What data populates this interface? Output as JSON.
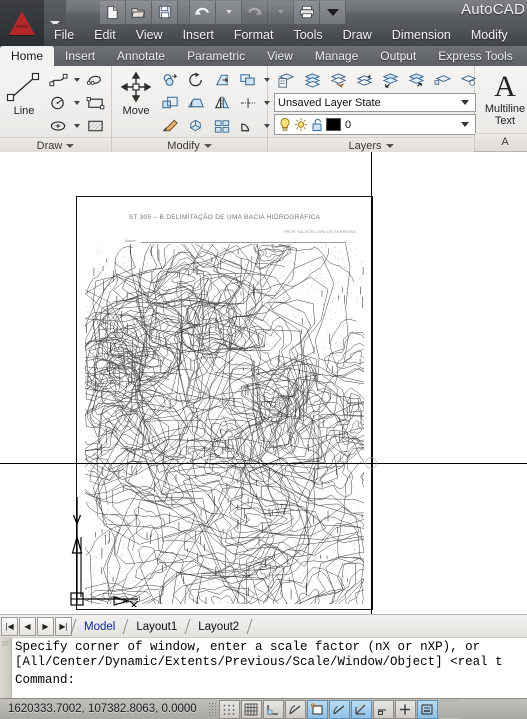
{
  "app": {
    "title": "AutoCAD",
    "logo_icon": "autocad-a-logo"
  },
  "quick_access": {
    "items": [
      {
        "name": "new-icon",
        "label": "New"
      },
      {
        "name": "open-icon",
        "label": "Open"
      },
      {
        "name": "save-icon",
        "label": "Save"
      },
      {
        "name": "undo-icon",
        "label": "Undo"
      },
      {
        "name": "redo-icon",
        "label": "Redo"
      },
      {
        "name": "plot-icon",
        "label": "Plot"
      },
      {
        "name": "chevron-down-icon",
        "label": "Customize Quick Access Toolbar"
      }
    ]
  },
  "menubar": {
    "items": [
      {
        "label": "File"
      },
      {
        "label": "Edit"
      },
      {
        "label": "View"
      },
      {
        "label": "Insert"
      },
      {
        "label": "Format"
      },
      {
        "label": "Tools"
      },
      {
        "label": "Draw"
      },
      {
        "label": "Dimension"
      },
      {
        "label": "Modify"
      }
    ]
  },
  "ribbon": {
    "tabs": [
      {
        "label": "Home",
        "active": true
      },
      {
        "label": "Insert",
        "active": false
      },
      {
        "label": "Annotate",
        "active": false
      },
      {
        "label": "Parametric",
        "active": false
      },
      {
        "label": "View",
        "active": false
      },
      {
        "label": "Manage",
        "active": false
      },
      {
        "label": "Output",
        "active": false
      },
      {
        "label": "Express Tools",
        "active": false
      }
    ],
    "panels": [
      {
        "title": "Draw",
        "big_button": {
          "label": "Line",
          "icon": "line-icon"
        },
        "buttons": [
          {
            "name": "polyline-icon",
            "dropdown": true
          },
          {
            "name": "spline-icon",
            "dropdown": false
          },
          {
            "name": "circle-icon",
            "dropdown": true
          },
          {
            "name": "rectangle-icon",
            "dropdown": false
          },
          {
            "name": "ellipse-icon",
            "dropdown": true
          },
          {
            "name": "hatch-icon",
            "dropdown": false
          }
        ]
      },
      {
        "title": "Modify",
        "big_button": {
          "label": "Move",
          "icon": "move-icon"
        },
        "buttons": [
          {
            "name": "copy-icon",
            "dropdown": false
          },
          {
            "name": "rotate-icon",
            "dropdown": false
          },
          {
            "name": "trim-icon",
            "dropdown": false
          },
          {
            "name": "array-icon",
            "dropdown": true
          },
          {
            "name": "scale-icon",
            "dropdown": false
          },
          {
            "name": "stretch-icon",
            "dropdown": false
          },
          {
            "name": "mirror-icon",
            "dropdown": false
          },
          {
            "name": "fillet-icon",
            "dropdown": true
          },
          {
            "name": "erase-icon",
            "dropdown": false
          },
          {
            "name": "explode-icon",
            "dropdown": false
          },
          {
            "name": "offset-icon",
            "dropdown": false
          },
          {
            "name": "chamfer-icon",
            "dropdown": true
          }
        ]
      },
      {
        "title": "Layers",
        "tools": [
          {
            "name": "layer-properties-icon"
          },
          {
            "name": "layer-isolate-icon"
          },
          {
            "name": "layer-freeze-icon"
          },
          {
            "name": "layer-match-icon"
          },
          {
            "name": "layer-previous-icon"
          },
          {
            "name": "layer-make-current-icon"
          },
          {
            "name": "layer-merge-icon"
          },
          {
            "name": "layer-walk-icon"
          }
        ],
        "layer_state": {
          "value": "Unsaved Layer State",
          "name": "layer-state-combo"
        },
        "current_layer": {
          "value": "0",
          "color_swatch": "#000000",
          "toggles": [
            "lightbulb-icon",
            "sun-icon",
            "unlock-icon"
          ],
          "name": "current-layer-combo"
        }
      },
      {
        "title": "A",
        "big_button": {
          "label_line1": "Multiline",
          "label_line2": "Text",
          "icon": "text-a-icon"
        }
      }
    ]
  },
  "drawing": {
    "sheet": {
      "title": "ST 305 – B   DELIMITAÇÃO DE UMA BACIA HIDROGRÁFICA",
      "subtitle": "PROF. NILSON  CARLOS FERREIRA",
      "label_left": "Nome:",
      "label_date": "Data:",
      "description": "scanned-topographic-contour-map"
    },
    "ucs_icon": "ucs-coordinate-icon",
    "crosshair": "crosshair-cursor"
  },
  "model_tabs": {
    "nav": [
      {
        "name": "first-tab-button",
        "glyph": "|◀"
      },
      {
        "name": "prev-tab-button",
        "glyph": "◀"
      },
      {
        "name": "next-tab-button",
        "glyph": "▶"
      },
      {
        "name": "last-tab-button",
        "glyph": "▶|"
      }
    ],
    "tabs": [
      {
        "label": "Model",
        "active": true
      },
      {
        "label": "Layout1",
        "active": false
      },
      {
        "label": "Layout2",
        "active": false
      }
    ]
  },
  "command_window": {
    "lines": [
      "Specify corner of window, enter a scale factor (nX or nXP), or",
      "[All/Center/Dynamic/Extents/Previous/Scale/Window/Object] <real t",
      "Command:"
    ]
  },
  "status_bar": {
    "coordinates": "1620333.7002, 107382.8063, 0.0000",
    "toggles": [
      {
        "name": "snap-mode-toggle",
        "label": "Snap",
        "active": false
      },
      {
        "name": "grid-display-toggle",
        "label": "Grid",
        "active": false
      },
      {
        "name": "ortho-mode-toggle",
        "label": "Ortho",
        "active": false
      },
      {
        "name": "polar-tracking-toggle",
        "label": "Polar",
        "active": false
      },
      {
        "name": "object-snap-toggle",
        "label": "Osnap",
        "active": true
      },
      {
        "name": "object-snap-tracking-toggle",
        "label": "Otrack",
        "active": false
      },
      {
        "name": "3d-object-snap-toggle",
        "label": "3D Osnap",
        "active": false
      },
      {
        "name": "dynamic-ucs-toggle",
        "label": "DUCS",
        "active": false
      },
      {
        "name": "dynamic-input-toggle",
        "label": "DYN",
        "active": false
      },
      {
        "name": "lineweight-toggle",
        "label": "LWT",
        "active": true
      }
    ]
  },
  "colors": {
    "accent_blue": "#11299b",
    "logo_red": "#b4282c",
    "canvas_bg": "#ffffff",
    "ribbon_bg": "#f3f2f0"
  }
}
